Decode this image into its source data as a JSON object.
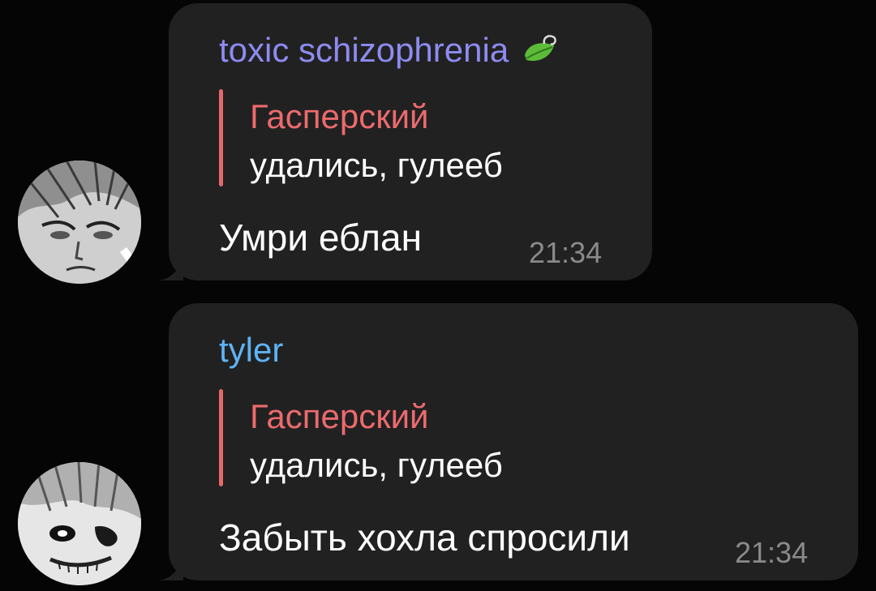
{
  "messages": [
    {
      "sender": "toxic schizophrenia",
      "sender_color": "#8e8bf2",
      "sender_badge": "leaf-icon",
      "reply": {
        "author": "Гасперский",
        "text": "удались, гулееб"
      },
      "text": "Умри еблан",
      "time": "21:34",
      "avatar": "manga-avatar-1"
    },
    {
      "sender": "tyler",
      "sender_color": "#5fb3f4",
      "reply": {
        "author": "Гасперский",
        "text": "удались, гулееб"
      },
      "text": "Забыть хохла спросили",
      "time": "21:34",
      "avatar": "manga-avatar-2"
    }
  ],
  "colors": {
    "background": "#050505",
    "bubble": "#212121",
    "reply_accent": "#e86769",
    "time": "#8a8a8a"
  }
}
